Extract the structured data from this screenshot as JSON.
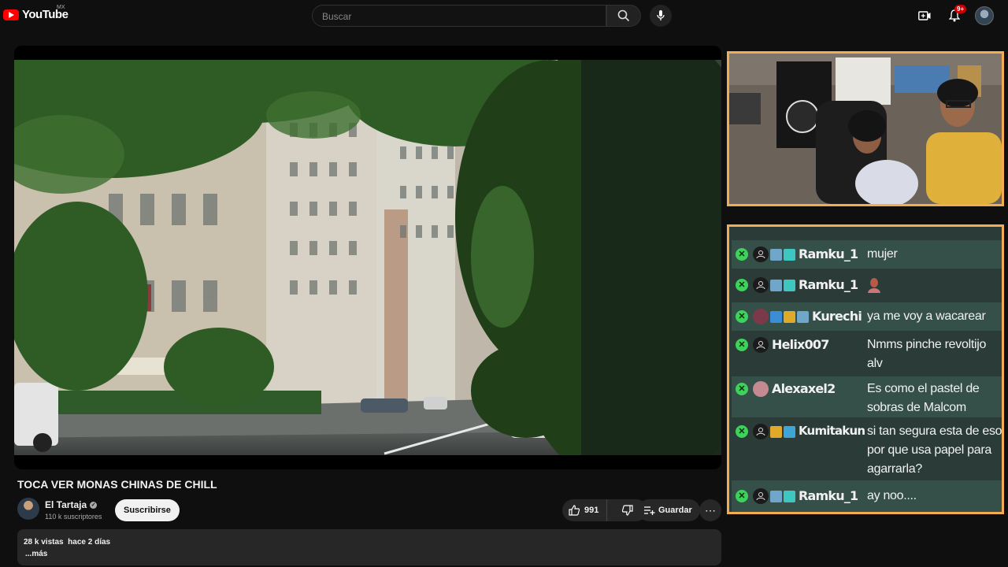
{
  "header": {
    "logo_text": "YouTube",
    "region": "MX",
    "search_placeholder": "Buscar",
    "notifications_count": "9+"
  },
  "video": {
    "title": "TOCA VER MONAS CHINAS DE CHILL",
    "channel_name": "El Tartaja",
    "subscribers": "110 k suscriptores",
    "subscribe_label": "Suscribirse",
    "likes": "991",
    "save_label": "Guardar",
    "more_label": "⋯",
    "views": "28 k vistas",
    "published": "hace 2 días",
    "desc_more": "...más"
  },
  "chat": {
    "messages": [
      {
        "user": "Ramku_1",
        "text": "mujer"
      },
      {
        "user": "Ramku_1",
        "text": ""
      },
      {
        "user": "Kurechi",
        "text": "ya me voy a wacarear"
      },
      {
        "user": "Helix007",
        "text": "Nmms pinche revoltijo alv"
      },
      {
        "user": "Alexaxel2",
        "text": "Es como el pastel de sobras de Malcom"
      },
      {
        "user": "Kumitakun",
        "text": "si tan segura esta de eso por que usa papel para agarrarla?"
      },
      {
        "user": "Ramku_1",
        "text": "ay noo...."
      }
    ]
  },
  "colors": {
    "accent": "#ff0000",
    "overlay_border": "#f2ad54",
    "chat_bg": "#2b3b37",
    "x_badge": "#3dd35a"
  }
}
